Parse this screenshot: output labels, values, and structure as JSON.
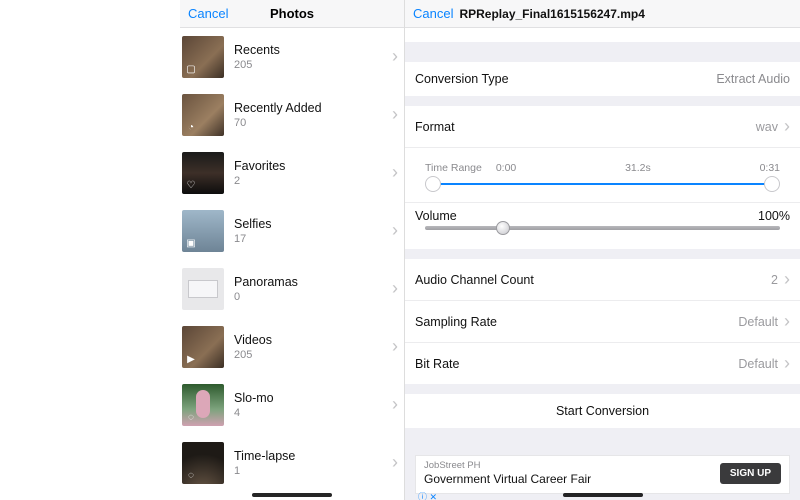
{
  "left": {
    "cancel": "Cancel",
    "title": "Photos",
    "albums": [
      {
        "name": "Recents",
        "count": "205",
        "cls": "recents",
        "badge": "▢"
      },
      {
        "name": "Recently Added",
        "count": "70",
        "cls": "recently",
        "badge": "◔"
      },
      {
        "name": "Favorites",
        "count": "2",
        "cls": "fav",
        "badge": "♡"
      },
      {
        "name": "Selfies",
        "count": "17",
        "cls": "selfies",
        "badge": "▣"
      },
      {
        "name": "Panoramas",
        "count": "0",
        "cls": "pano",
        "badge": ""
      },
      {
        "name": "Videos",
        "count": "205",
        "cls": "videos",
        "badge": "▶"
      },
      {
        "name": "Slo-mo",
        "count": "4",
        "cls": "slomo",
        "badge": "◌"
      },
      {
        "name": "Time-lapse",
        "count": "1",
        "cls": "timelapse",
        "badge": "◌"
      }
    ]
  },
  "right": {
    "cancel": "Cancel",
    "filename": "RPReplay_Final1615156247.mp4",
    "conversion_type": {
      "label": "Conversion Type",
      "value": "Extract Audio"
    },
    "format": {
      "label": "Format",
      "value": "wav"
    },
    "time_range": {
      "label": "Time Range",
      "start": "0:00",
      "duration": "31.2s",
      "end": "0:31"
    },
    "volume": {
      "label": "Volume",
      "value": "100%",
      "knob_pct": 22
    },
    "channel": {
      "label": "Audio Channel Count",
      "value": "2"
    },
    "sampling": {
      "label": "Sampling Rate",
      "value": "Default"
    },
    "bitrate": {
      "label": "Bit Rate",
      "value": "Default"
    },
    "start": "Start Conversion",
    "ad": {
      "small": "JobStreet PH",
      "main": "Government Virtual Career Fair",
      "button": "SIGN UP",
      "info": "ⓘ ✕"
    }
  }
}
